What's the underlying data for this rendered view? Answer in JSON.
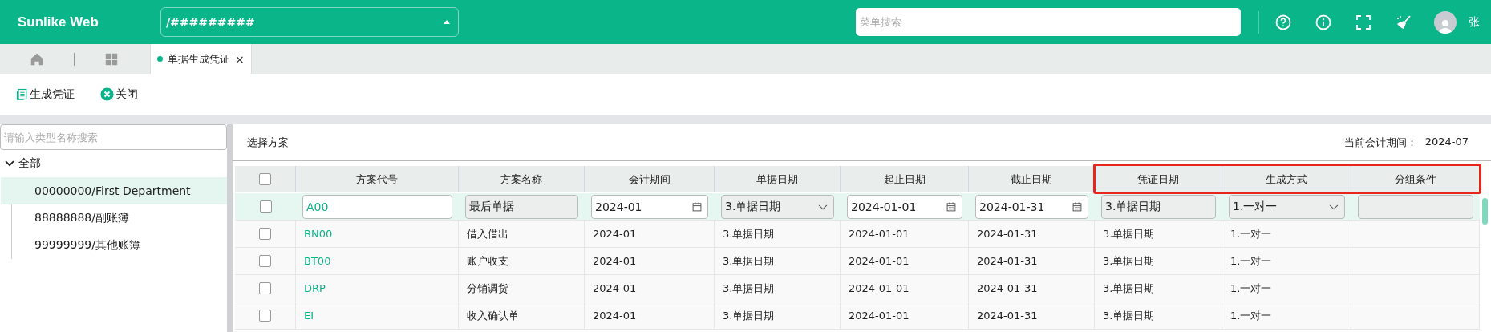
{
  "header": {
    "logo": "Sunlike Web",
    "company_select": "/#########",
    "menu_search": {
      "placeholder": "菜单搜索"
    },
    "user_name": "张"
  },
  "tabs": [
    {
      "label": "单据生成凭证",
      "close": "×",
      "selected": true
    }
  ],
  "toolbar": [
    {
      "kind": "generate",
      "label": "生成凭证"
    },
    {
      "kind": "close",
      "label": "关闭"
    }
  ],
  "sidebar": {
    "search": {
      "placeholder": "请输入类型名称搜索"
    },
    "tree": [
      {
        "label": "全部",
        "expanded": true,
        "selected": false,
        "children": [
          {
            "label": "00000000/First Department",
            "selected": true
          },
          {
            "label": "88888888/副账簿",
            "selected": false
          },
          {
            "label": "99999999/其他账簿",
            "selected": false
          }
        ]
      }
    ]
  },
  "panel": {
    "title": "选择方案",
    "period_label": "当前会计期间：",
    "period_value": "2024-07"
  },
  "table": {
    "select_all": {
      "checked": false
    },
    "columns": [
      {
        "label": "方案代号",
        "highlighted": false
      },
      {
        "label": "方案名称",
        "highlighted": false
      },
      {
        "label": "会计期间",
        "highlighted": false
      },
      {
        "label": "单据日期",
        "highlighted": false
      },
      {
        "label": "起止日期",
        "highlighted": false
      },
      {
        "label": "截止日期",
        "highlighted": false
      },
      {
        "label": "凭证日期",
        "highlighted": true
      },
      {
        "label": "生成方式",
        "highlighted": true
      },
      {
        "label": "分组条件",
        "highlighted": true
      }
    ],
    "edit_row": {
      "checked": false,
      "selected": true,
      "cells": [
        {
          "kind": "text",
          "value": "A00"
        },
        {
          "kind": "readonly",
          "value": "最后单据"
        },
        {
          "kind": "month",
          "value": "2024-01"
        },
        {
          "kind": "select",
          "value": "3.单据日期"
        },
        {
          "kind": "date",
          "value": "2024-01-01"
        },
        {
          "kind": "date",
          "value": "2024-01-31"
        },
        {
          "kind": "readonly",
          "value": "3.单据日期"
        },
        {
          "kind": "select",
          "value": "1.一对一"
        },
        {
          "kind": "readonly"
        }
      ]
    },
    "rows": [
      {
        "checked": false,
        "cells": [
          "BN00",
          "借入借出",
          "2024-01",
          "3.单据日期",
          "2024-01-01",
          "2024-01-31",
          "3.单据日期",
          "1.一对一"
        ]
      },
      {
        "checked": false,
        "cells": [
          "BT00",
          "账户收支",
          "2024-01",
          "3.单据日期",
          "2024-01-01",
          "2024-01-31",
          "3.单据日期",
          "1.一对一"
        ]
      },
      {
        "checked": false,
        "cells": [
          "DRP",
          "分销调货",
          "2024-01",
          "3.单据日期",
          "2024-01-01",
          "2024-01-31",
          "3.单据日期",
          "1.一对一"
        ]
      },
      {
        "checked": false,
        "cells": [
          "EI",
          "收入确认单",
          "2024-01",
          "3.单据日期",
          "2024-01-01",
          "2024-01-31",
          "3.单据日期",
          "1.一对一"
        ]
      }
    ]
  }
}
